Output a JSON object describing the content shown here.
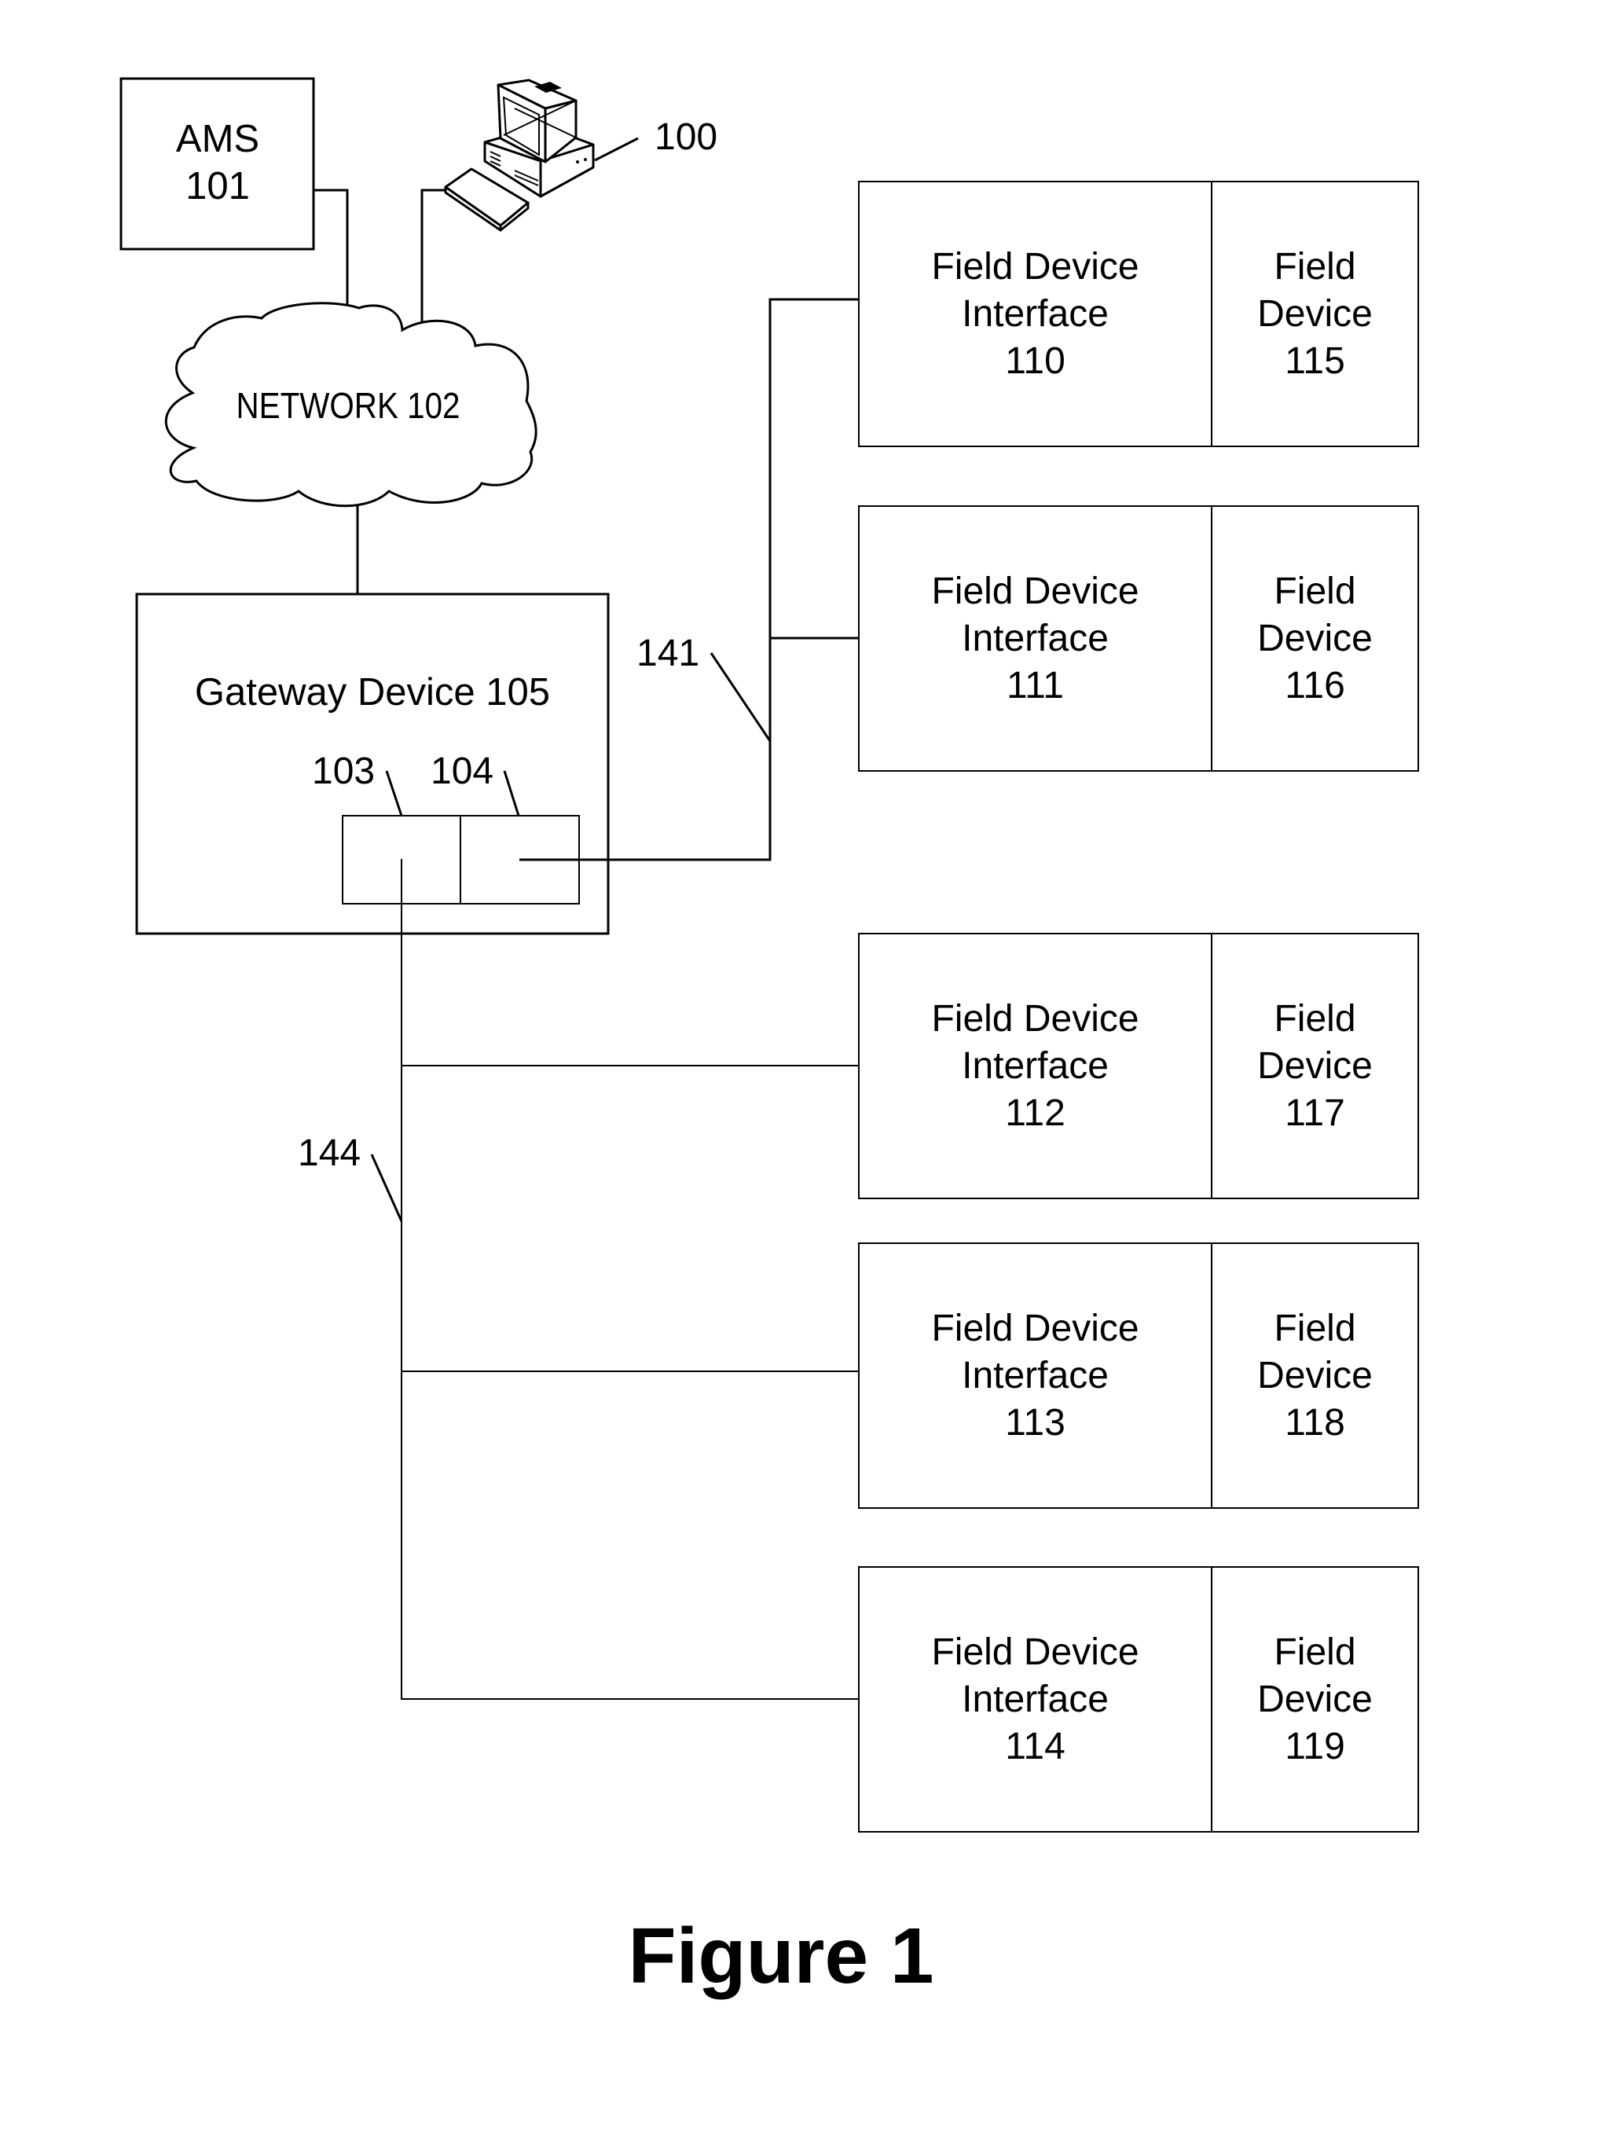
{
  "figure": {
    "caption": "Figure 1",
    "computer": {
      "ref": "100",
      "icon": "desktop-computer-icon"
    },
    "ams": {
      "line1": "AMS",
      "line2": "101"
    },
    "network": {
      "label": "NETWORK 102",
      "icon": "cloud-icon"
    },
    "gateway": {
      "title": "Gateway Device 105",
      "port_a_ref": "103",
      "port_b_ref": "104"
    },
    "buses": {
      "bus_a_ref": "141",
      "bus_b_ref": "144"
    },
    "field_rows": [
      {
        "interface": [
          "Field Device",
          "Interface",
          "110"
        ],
        "device": [
          "Field",
          "Device",
          "115"
        ]
      },
      {
        "interface": [
          "Field Device",
          "Interface",
          "111"
        ],
        "device": [
          "Field",
          "Device",
          "116"
        ]
      },
      {
        "interface": [
          "Field Device",
          "Interface",
          "112"
        ],
        "device": [
          "Field",
          "Device",
          "117"
        ]
      },
      {
        "interface": [
          "Field Device",
          "Interface",
          "113"
        ],
        "device": [
          "Field",
          "Device",
          "118"
        ]
      },
      {
        "interface": [
          "Field Device",
          "Interface",
          "114"
        ],
        "device": [
          "Field",
          "Device",
          "119"
        ]
      }
    ]
  }
}
